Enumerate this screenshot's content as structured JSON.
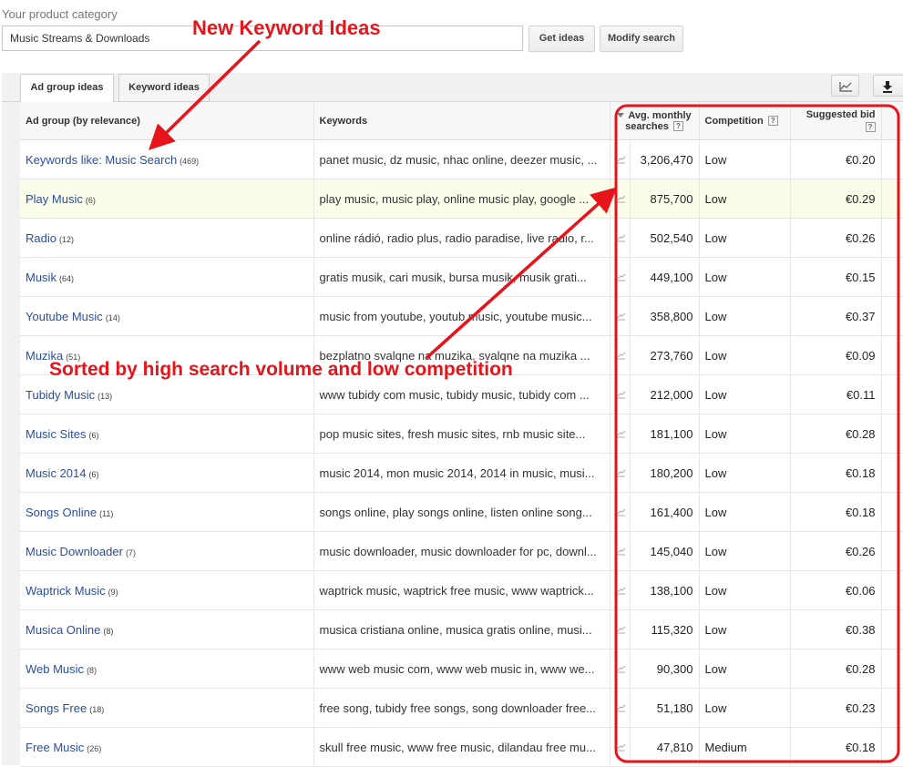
{
  "search": {
    "category_label": "Your product category",
    "category_value": "Music Streams & Downloads",
    "get_ideas_label": "Get ideas",
    "modify_search_label": "Modify search"
  },
  "tabs": [
    {
      "label": "Ad group ideas",
      "active": true
    },
    {
      "label": "Keyword ideas",
      "active": false
    }
  ],
  "toolbar": {
    "chart_icon": "line-chart-icon",
    "download_icon": "download-icon"
  },
  "table": {
    "headers": {
      "ad_group": "Ad group (by relevance)",
      "keywords": "Keywords",
      "avg_monthly_searches": "Avg. monthly searches",
      "competition": "Competition",
      "suggested_bid": "Suggested bid"
    },
    "rows": [
      {
        "group": "Keywords like: Music Search",
        "count": "(469)",
        "keywords": "panet music, dz music, nhac online, deezer music, ...",
        "searches": "3,206,470",
        "competition": "Low",
        "bid": "€0.20"
      },
      {
        "group": "Play Music",
        "count": "(6)",
        "keywords": "play music, music play, online music play, google ...",
        "searches": "875,700",
        "competition": "Low",
        "bid": "€0.29"
      },
      {
        "group": "Radio",
        "count": "(12)",
        "keywords": "online rádió, radio plus, radio paradise, live radio, r...",
        "searches": "502,540",
        "competition": "Low",
        "bid": "€0.26"
      },
      {
        "group": "Musik",
        "count": "(64)",
        "keywords": "gratis musik, cari musik, bursa musik, musik grati...",
        "searches": "449,100",
        "competition": "Low",
        "bid": "€0.15"
      },
      {
        "group": "Youtube Music",
        "count": "(14)",
        "keywords": "music from youtube, youtub music, youtube music...",
        "searches": "358,800",
        "competition": "Low",
        "bid": "€0.37"
      },
      {
        "group": "Muzika",
        "count": "(51)",
        "keywords": "bezplatno svalqne na muzika, svalqne na muzika ...",
        "searches": "273,760",
        "competition": "Low",
        "bid": "€0.09"
      },
      {
        "group": "Tubidy Music",
        "count": "(13)",
        "keywords": "www tubidy com music, tubidy music, tubidy com ...",
        "searches": "212,000",
        "competition": "Low",
        "bid": "€0.11"
      },
      {
        "group": "Music Sites",
        "count": "(6)",
        "keywords": "pop music sites, fresh music sites, rnb music site...",
        "searches": "181,100",
        "competition": "Low",
        "bid": "€0.28"
      },
      {
        "group": "Music 2014",
        "count": "(6)",
        "keywords": "music 2014, mon music 2014, 2014 in music, musi...",
        "searches": "180,200",
        "competition": "Low",
        "bid": "€0.18"
      },
      {
        "group": "Songs Online",
        "count": "(11)",
        "keywords": "songs online, play songs online, listen online song...",
        "searches": "161,400",
        "competition": "Low",
        "bid": "€0.18"
      },
      {
        "group": "Music Downloader",
        "count": "(7)",
        "keywords": "music downloader, music downloader for pc, downl...",
        "searches": "145,040",
        "competition": "Low",
        "bid": "€0.26"
      },
      {
        "group": "Waptrick Music",
        "count": "(9)",
        "keywords": "waptrick music, waptrick free music, www waptrick...",
        "searches": "138,100",
        "competition": "Low",
        "bid": "€0.06"
      },
      {
        "group": "Musica Online",
        "count": "(8)",
        "keywords": "musica cristiana online, musica gratis online, musi...",
        "searches": "115,320",
        "competition": "Low",
        "bid": "€0.38"
      },
      {
        "group": "Web Music",
        "count": "(8)",
        "keywords": "www web music com, www web music in, www we...",
        "searches": "90,300",
        "competition": "Low",
        "bid": "€0.28"
      },
      {
        "group": "Songs Free",
        "count": "(18)",
        "keywords": "free song, tubidy free songs, song downloader free...",
        "searches": "51,180",
        "competition": "Low",
        "bid": "€0.23"
      },
      {
        "group": "Free Music",
        "count": "(26)",
        "keywords": "skull free music, www free music, dilandau free mu...",
        "searches": "47,810",
        "competition": "Medium",
        "bid": "€0.18"
      }
    ]
  },
  "annotations": {
    "new_keyword_ideas": "New Keyword Ideas",
    "sorted_note": "Sorted by high search volume and low competition",
    "color": "#e8141b"
  }
}
